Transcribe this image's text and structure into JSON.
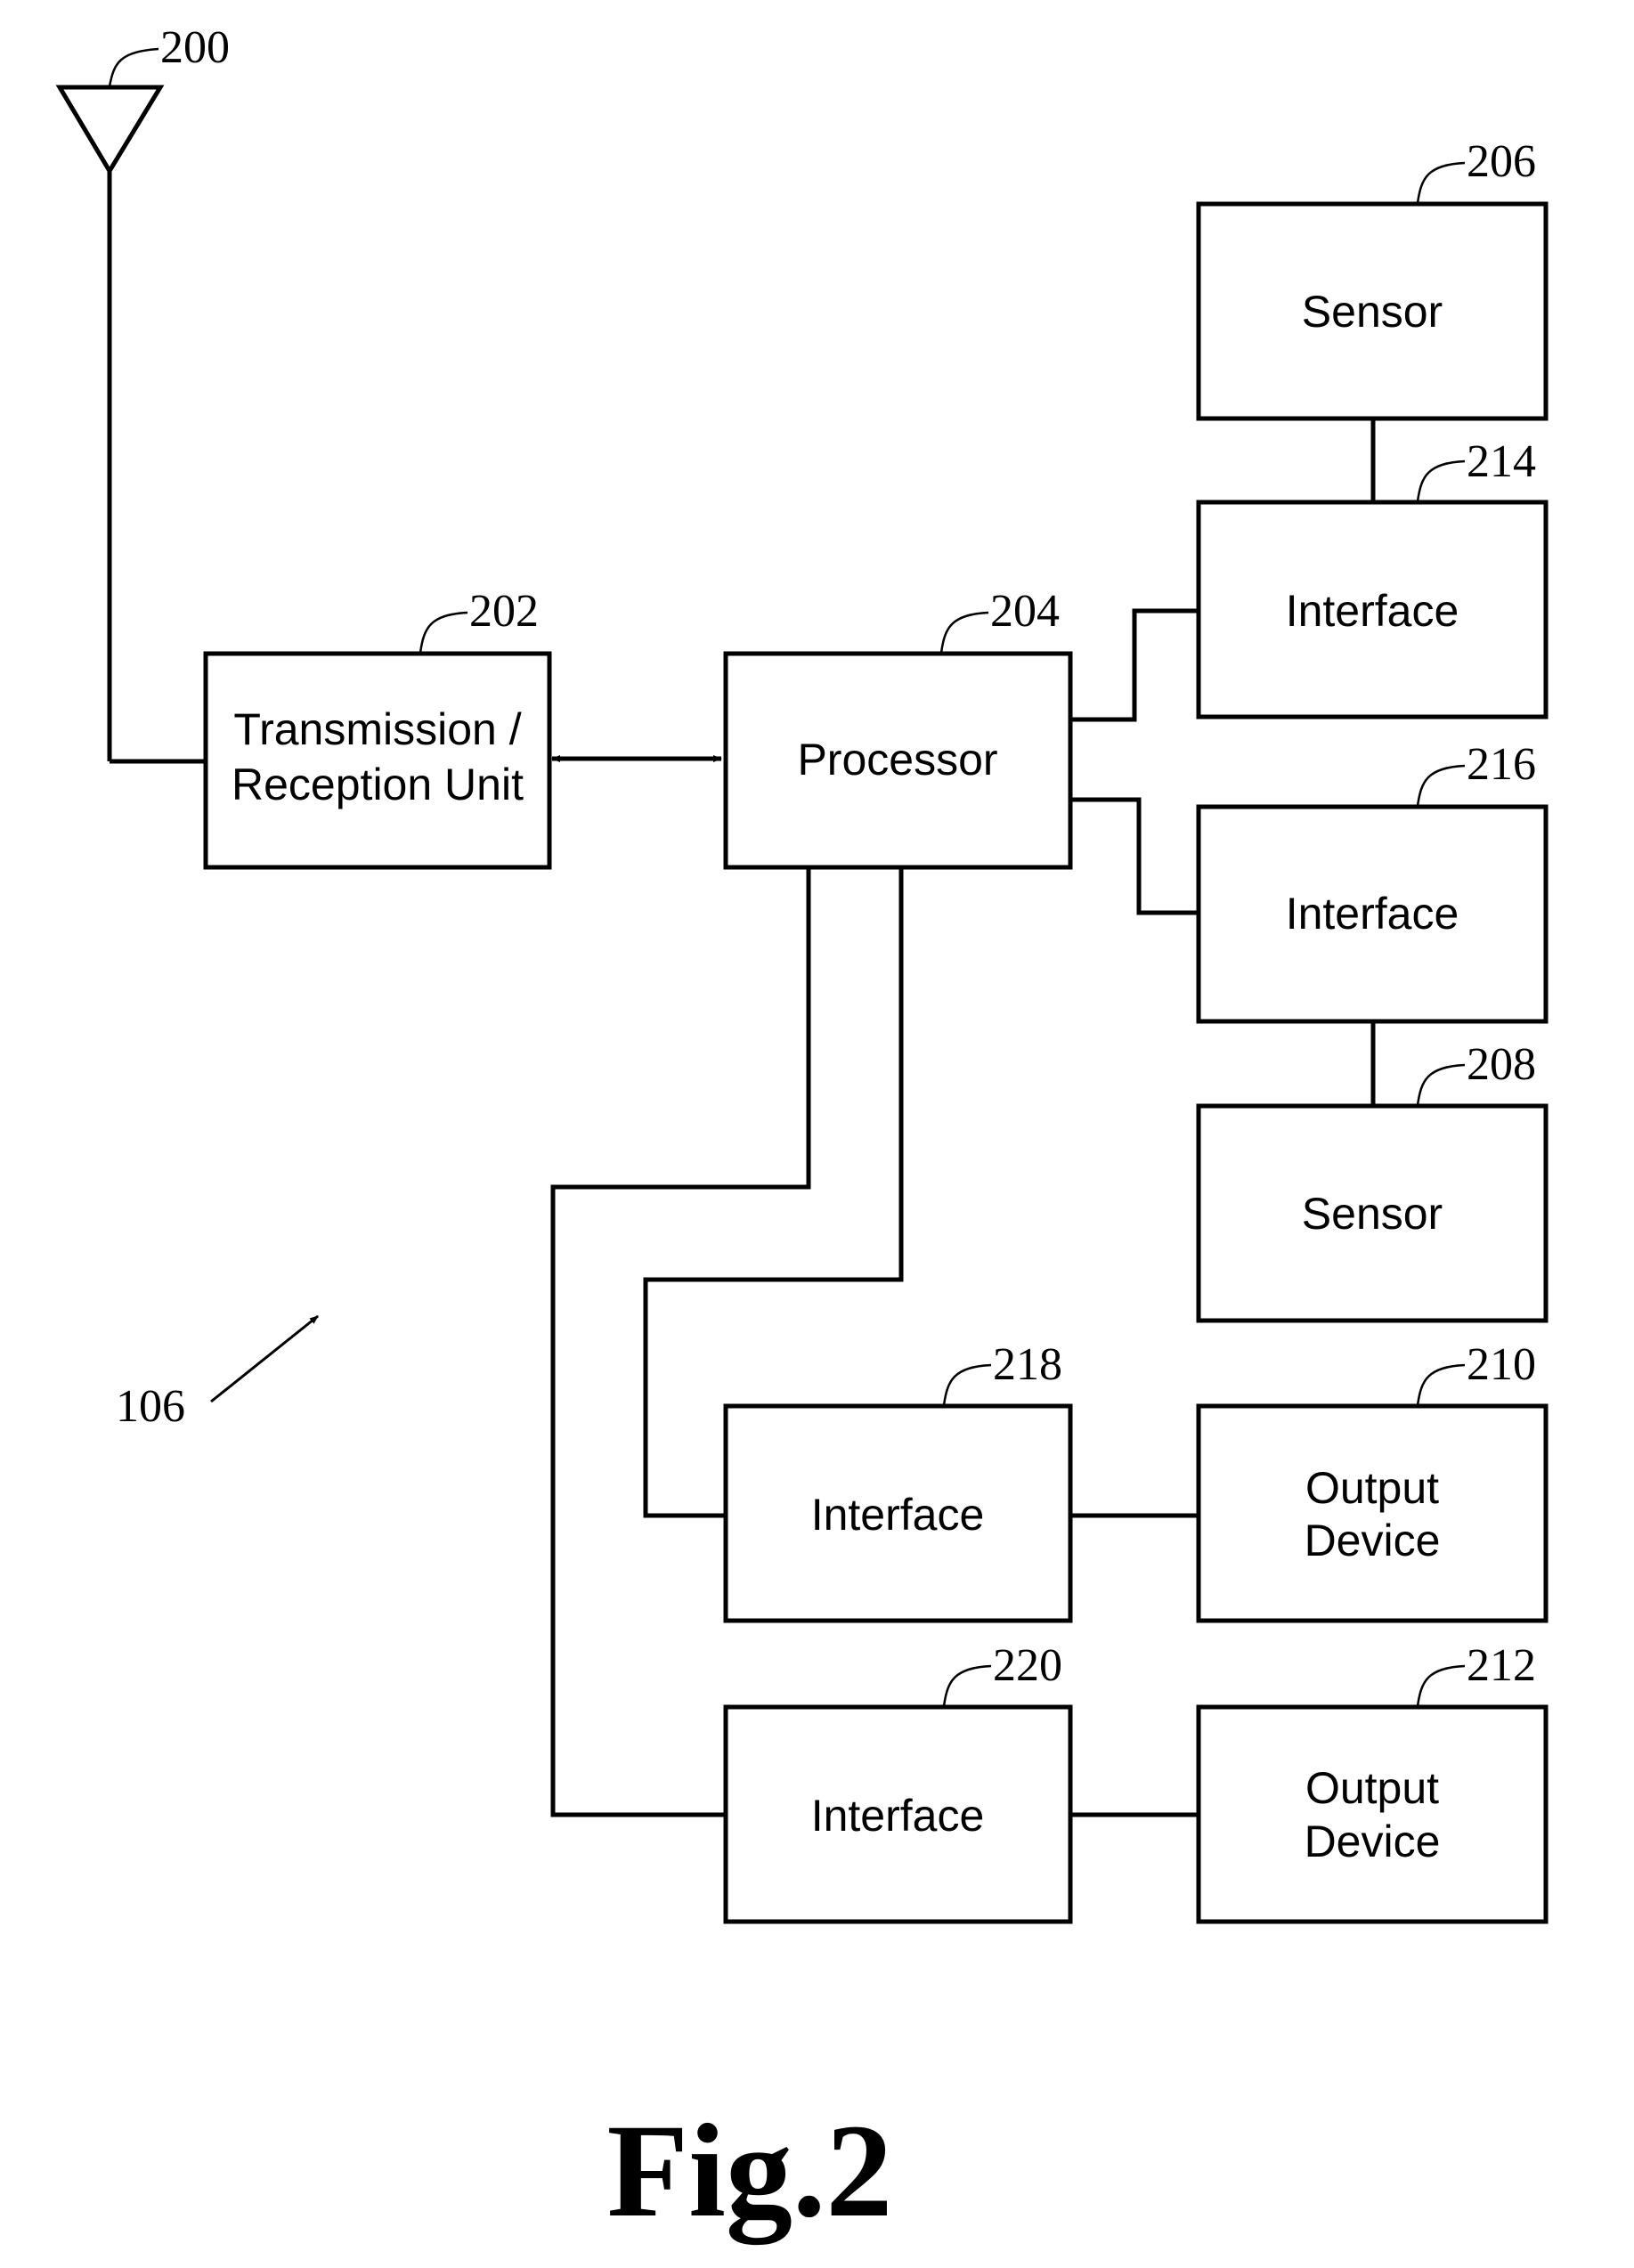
{
  "figure": {
    "caption": "Fig.2",
    "device_ref": "106",
    "antenna": {
      "ref": "200"
    },
    "blocks": {
      "trx": {
        "ref": "202",
        "lines": [
          "Transmission /",
          "Reception Unit"
        ]
      },
      "processor": {
        "ref": "204",
        "lines": [
          "Processor"
        ]
      },
      "sensor1": {
        "ref": "206",
        "lines": [
          "Sensor"
        ]
      },
      "sensor2": {
        "ref": "208",
        "lines": [
          "Sensor"
        ]
      },
      "output1": {
        "ref": "210",
        "lines": [
          "Output",
          "Device"
        ]
      },
      "output2": {
        "ref": "212",
        "lines": [
          "Output",
          "Device"
        ]
      },
      "if214": {
        "ref": "214",
        "lines": [
          "Interface"
        ]
      },
      "if216": {
        "ref": "216",
        "lines": [
          "Interface"
        ]
      },
      "if218": {
        "ref": "218",
        "lines": [
          "Interface"
        ]
      },
      "if220": {
        "ref": "220",
        "lines": [
          "Interface"
        ]
      }
    }
  }
}
